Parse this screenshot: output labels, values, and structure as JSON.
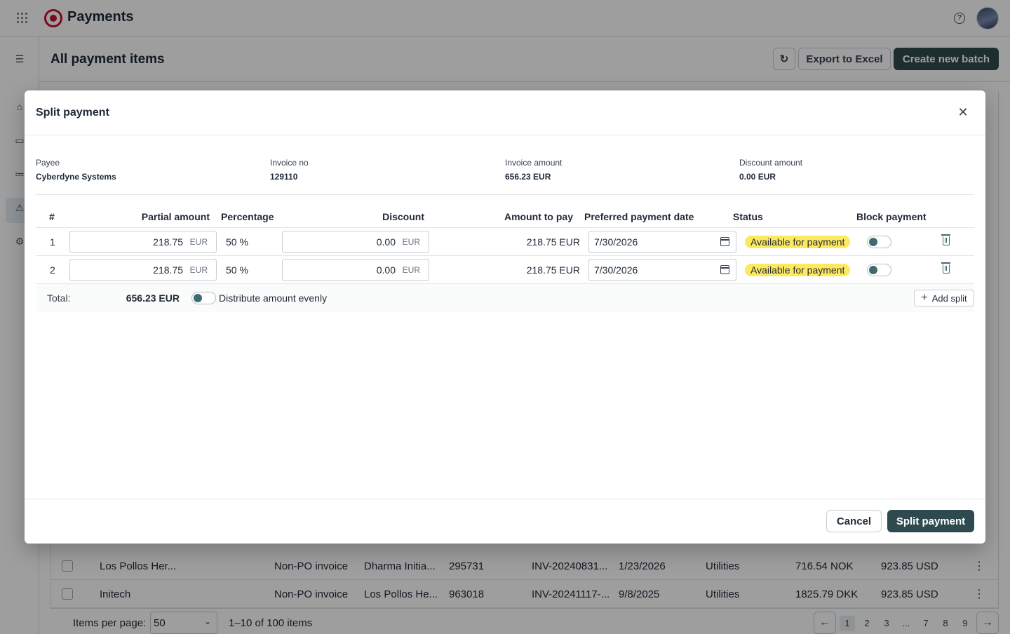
{
  "app": {
    "title": "Payments",
    "page_title": "All payment items",
    "header_buttons": {
      "refresh_icon": "refresh-icon",
      "export_label": "Export to Excel",
      "create_label": "Create new batch"
    },
    "icons": [
      "apps-grid-icon",
      "help-icon",
      "home-icon",
      "payments-icon",
      "list-icon",
      "warning-icon",
      "settings-icon"
    ]
  },
  "background_rows": [
    {
      "payee": "Los Pollos Her...",
      "type": "Non-PO invoice",
      "company": "Dharma Initia...",
      "id": "295731",
      "invoice": "INV-20240831...",
      "date": "1/23/2026",
      "category": "Utilities",
      "amount": "716.54 NOK",
      "converted": "923.85 USD"
    },
    {
      "payee": "Initech",
      "type": "Non-PO invoice",
      "company": "Los Pollos He...",
      "id": "963018",
      "invoice": "INV-20241117-...",
      "date": "9/8/2025",
      "category": "Utilities",
      "amount": "1825.79 DKK",
      "converted": "923.85 USD"
    }
  ],
  "pager": {
    "items_per_page_label": "Items per page:",
    "items_per_page_value": "50",
    "range_text": "1–10 of 100 items",
    "pages": [
      "1",
      "2",
      "3",
      "...",
      "7",
      "8",
      "9"
    ],
    "current_page": "1"
  },
  "modal": {
    "title": "Split payment",
    "info": {
      "payee_label": "Payee",
      "payee_value": "Cyberdyne Systems",
      "invoice_no_label": "Invoice no",
      "invoice_no_value": "129110",
      "invoice_amount_label": "Invoice amount",
      "invoice_amount_value": "656.23 EUR",
      "discount_amount_label": "Discount amount",
      "discount_amount_value": "0.00 EUR"
    },
    "columns": {
      "index": "#",
      "partial_amount": "Partial amount",
      "percentage": "Percentage",
      "discount": "Discount",
      "amount_to_pay": "Amount to pay",
      "preferred_date": "Preferred payment date",
      "status": "Status",
      "block_payment": "Block payment"
    },
    "splits": [
      {
        "index": "1",
        "partial_amount": "218.75",
        "currency": "EUR",
        "percentage": "50 %",
        "discount": "0.00",
        "discount_currency": "EUR",
        "amount_to_pay": "218.75 EUR",
        "date": "7/30/2026",
        "status": "Available for payment",
        "blocked": false
      },
      {
        "index": "2",
        "partial_amount": "218.75",
        "currency": "EUR",
        "percentage": "50 %",
        "discount": "0.00",
        "discount_currency": "EUR",
        "amount_to_pay": "218.75 EUR",
        "date": "7/30/2026",
        "status": "Available for payment",
        "blocked": false
      }
    ],
    "total_label": "Total:",
    "total_value": "656.23 EUR",
    "distribute_label": "Distribute amount evenly",
    "distribute_enabled": false,
    "add_split_label": "Add split",
    "cancel_label": "Cancel",
    "submit_label": "Split payment"
  },
  "colors": {
    "primary": "#2f4a4e",
    "status_badge": "#fde95f",
    "brand": "#c8102e"
  }
}
